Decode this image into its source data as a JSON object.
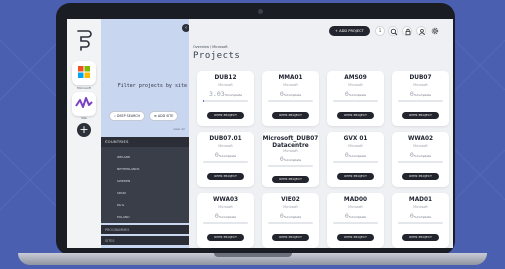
{
  "colors": {
    "background": "#4a5fb0",
    "panel": "#c9d6f0",
    "dark": "#22252d",
    "progress": "#4b62b8"
  },
  "sites": [
    {
      "label": "Microsoft",
      "icon": "microsoft-logo-icon"
    },
    {
      "label": "Site",
      "icon": "waveform-logo-icon"
    }
  ],
  "filter": {
    "title": "Filter projects by site",
    "deep_search": "DEEP SEARCH",
    "add_site": "ADD SITE",
    "clear": "clear all"
  },
  "countries": {
    "header": "COUNTRIES",
    "items": [
      "IRELAND",
      "NETHERLANDS",
      "SWEDEN",
      "SPAIN",
      "Paris",
      "POLAND"
    ]
  },
  "sections": [
    "PROGRAMMES",
    "SITES"
  ],
  "header": {
    "add_project": "+ ADD PROJECT",
    "badge": "1"
  },
  "breadcrumb": "Overview / Microsoft",
  "title": "Projects",
  "projects": [
    {
      "name": "DUB12",
      "org": "Microsoft",
      "percent": "3.03",
      "suffix": "%Complete",
      "progress": 0.0303,
      "button": "OPEN PROJECT"
    },
    {
      "name": "MMA01",
      "org": "Microsoft",
      "percent": "0",
      "suffix": "%Complete",
      "progress": 0,
      "button": "OPEN PROJECT"
    },
    {
      "name": "AMS09",
      "org": "Microsoft",
      "percent": "0",
      "suffix": "%Complete",
      "progress": 0,
      "button": "OPEN PROJECT"
    },
    {
      "name": "DUB07",
      "org": "Microsoft",
      "percent": "0",
      "suffix": "%Complete",
      "progress": 0,
      "button": "OPEN PROJECT"
    },
    {
      "name": "DUB07.01",
      "org": "Microsoft",
      "percent": "0",
      "suffix": "%Complete",
      "progress": 0,
      "button": "OPEN PROJECT"
    },
    {
      "name": "Microsoft_DUB07 Datacentre",
      "org": "Microsoft",
      "percent": "0",
      "suffix": "%Complete",
      "progress": 0,
      "button": "OPEN PROJECT"
    },
    {
      "name": "GVX 01",
      "org": "Microsoft",
      "percent": "0",
      "suffix": "%Complete",
      "progress": 0,
      "button": "OPEN PROJECT"
    },
    {
      "name": "WWA02",
      "org": "Microsoft",
      "percent": "0",
      "suffix": "%Complete",
      "progress": 0,
      "button": "OPEN PROJECT"
    },
    {
      "name": "WWA03",
      "org": "Microsoft",
      "percent": "0",
      "suffix": "%Complete",
      "progress": 0,
      "button": "OPEN PROJECT"
    },
    {
      "name": "VIE02",
      "org": "Microsoft",
      "percent": "0",
      "suffix": "%Complete",
      "progress": 0,
      "button": "OPEN PROJECT"
    },
    {
      "name": "MAD00",
      "org": "Microsoft",
      "percent": "0",
      "suffix": "%Complete",
      "progress": 0,
      "button": "OPEN PROJECT"
    },
    {
      "name": "MAD01",
      "org": "Microsoft",
      "percent": "0",
      "suffix": "%Complete",
      "progress": 0,
      "button": "OPEN PROJECT"
    }
  ]
}
